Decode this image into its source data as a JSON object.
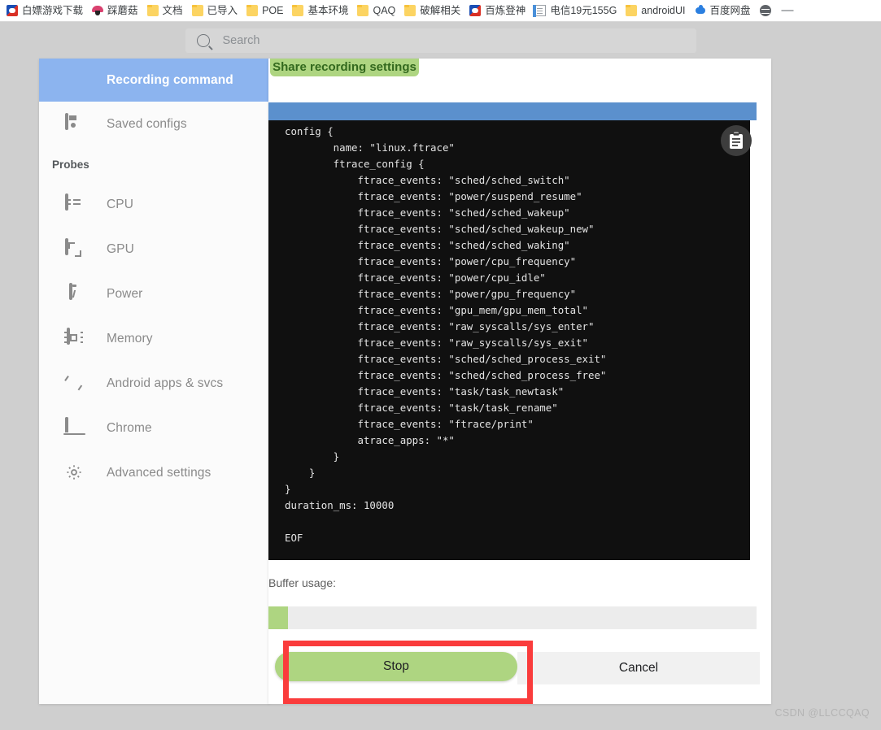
{
  "bookmarks": {
    "items": [
      {
        "label": "白嫖游戏下载",
        "icon": "game-icon"
      },
      {
        "label": "踩蘑菇",
        "icon": "mushroom-icon"
      },
      {
        "label": "文档",
        "icon": "folder-icon"
      },
      {
        "label": "已导入",
        "icon": "folder-icon"
      },
      {
        "label": "POE",
        "icon": "folder-icon"
      },
      {
        "label": "基本环境",
        "icon": "folder-icon"
      },
      {
        "label": "QAQ",
        "icon": "folder-icon"
      },
      {
        "label": "破解相关",
        "icon": "folder-icon"
      },
      {
        "label": "百炼登神",
        "icon": "game-icon"
      },
      {
        "label": "电信19元155G",
        "icon": "document-icon"
      },
      {
        "label": "androidUI",
        "icon": "folder-icon"
      },
      {
        "label": "百度网盘",
        "icon": "cloud-icon"
      }
    ],
    "trailing_icon": "globe-icon",
    "overflow": "—"
  },
  "search": {
    "placeholder": "Search",
    "icon": "search-icon"
  },
  "sidebar": {
    "items": [
      {
        "label": "Recording command",
        "icon": "record-dot-icon",
        "active": true
      },
      {
        "label": "Saved configs",
        "icon": "floppy-icon",
        "active": false
      }
    ],
    "section_header": "Probes",
    "probes": [
      {
        "label": "CPU",
        "icon": "cpu-icon"
      },
      {
        "label": "GPU",
        "icon": "gpu-icon"
      },
      {
        "label": "Power",
        "icon": "battery-icon"
      },
      {
        "label": "Memory",
        "icon": "memory-chip-icon"
      },
      {
        "label": "Android apps & svcs",
        "icon": "android-icon"
      },
      {
        "label": "Chrome",
        "icon": "laptop-icon"
      },
      {
        "label": "Advanced settings",
        "icon": "gear-icon"
      }
    ]
  },
  "main": {
    "share_button": "Share recording settings",
    "copy_icon": "clipboard-copy-icon",
    "code": "config {\n        name: \"linux.ftrace\"\n        ftrace_config {\n            ftrace_events: \"sched/sched_switch\"\n            ftrace_events: \"power/suspend_resume\"\n            ftrace_events: \"sched/sched_wakeup\"\n            ftrace_events: \"sched/sched_wakeup_new\"\n            ftrace_events: \"sched/sched_waking\"\n            ftrace_events: \"power/cpu_frequency\"\n            ftrace_events: \"power/cpu_idle\"\n            ftrace_events: \"power/gpu_frequency\"\n            ftrace_events: \"gpu_mem/gpu_mem_total\"\n            ftrace_events: \"raw_syscalls/sys_enter\"\n            ftrace_events: \"raw_syscalls/sys_exit\"\n            ftrace_events: \"sched/sched_process_exit\"\n            ftrace_events: \"sched/sched_process_free\"\n            ftrace_events: \"task/task_newtask\"\n            ftrace_events: \"task/task_rename\"\n            ftrace_events: \"ftrace/print\"\n            atrace_apps: \"*\"\n        }\n    }\n}\nduration_ms: 10000\n\nEOF",
    "buffer_label": "Buffer usage:",
    "buffer_percent": 4,
    "stop_label": "Stop",
    "cancel_label": "Cancel"
  },
  "annotation": {
    "highlight_color": "#fa3c3c",
    "target": "Stop"
  },
  "watermark": "CSDN @LLCCQAQ"
}
